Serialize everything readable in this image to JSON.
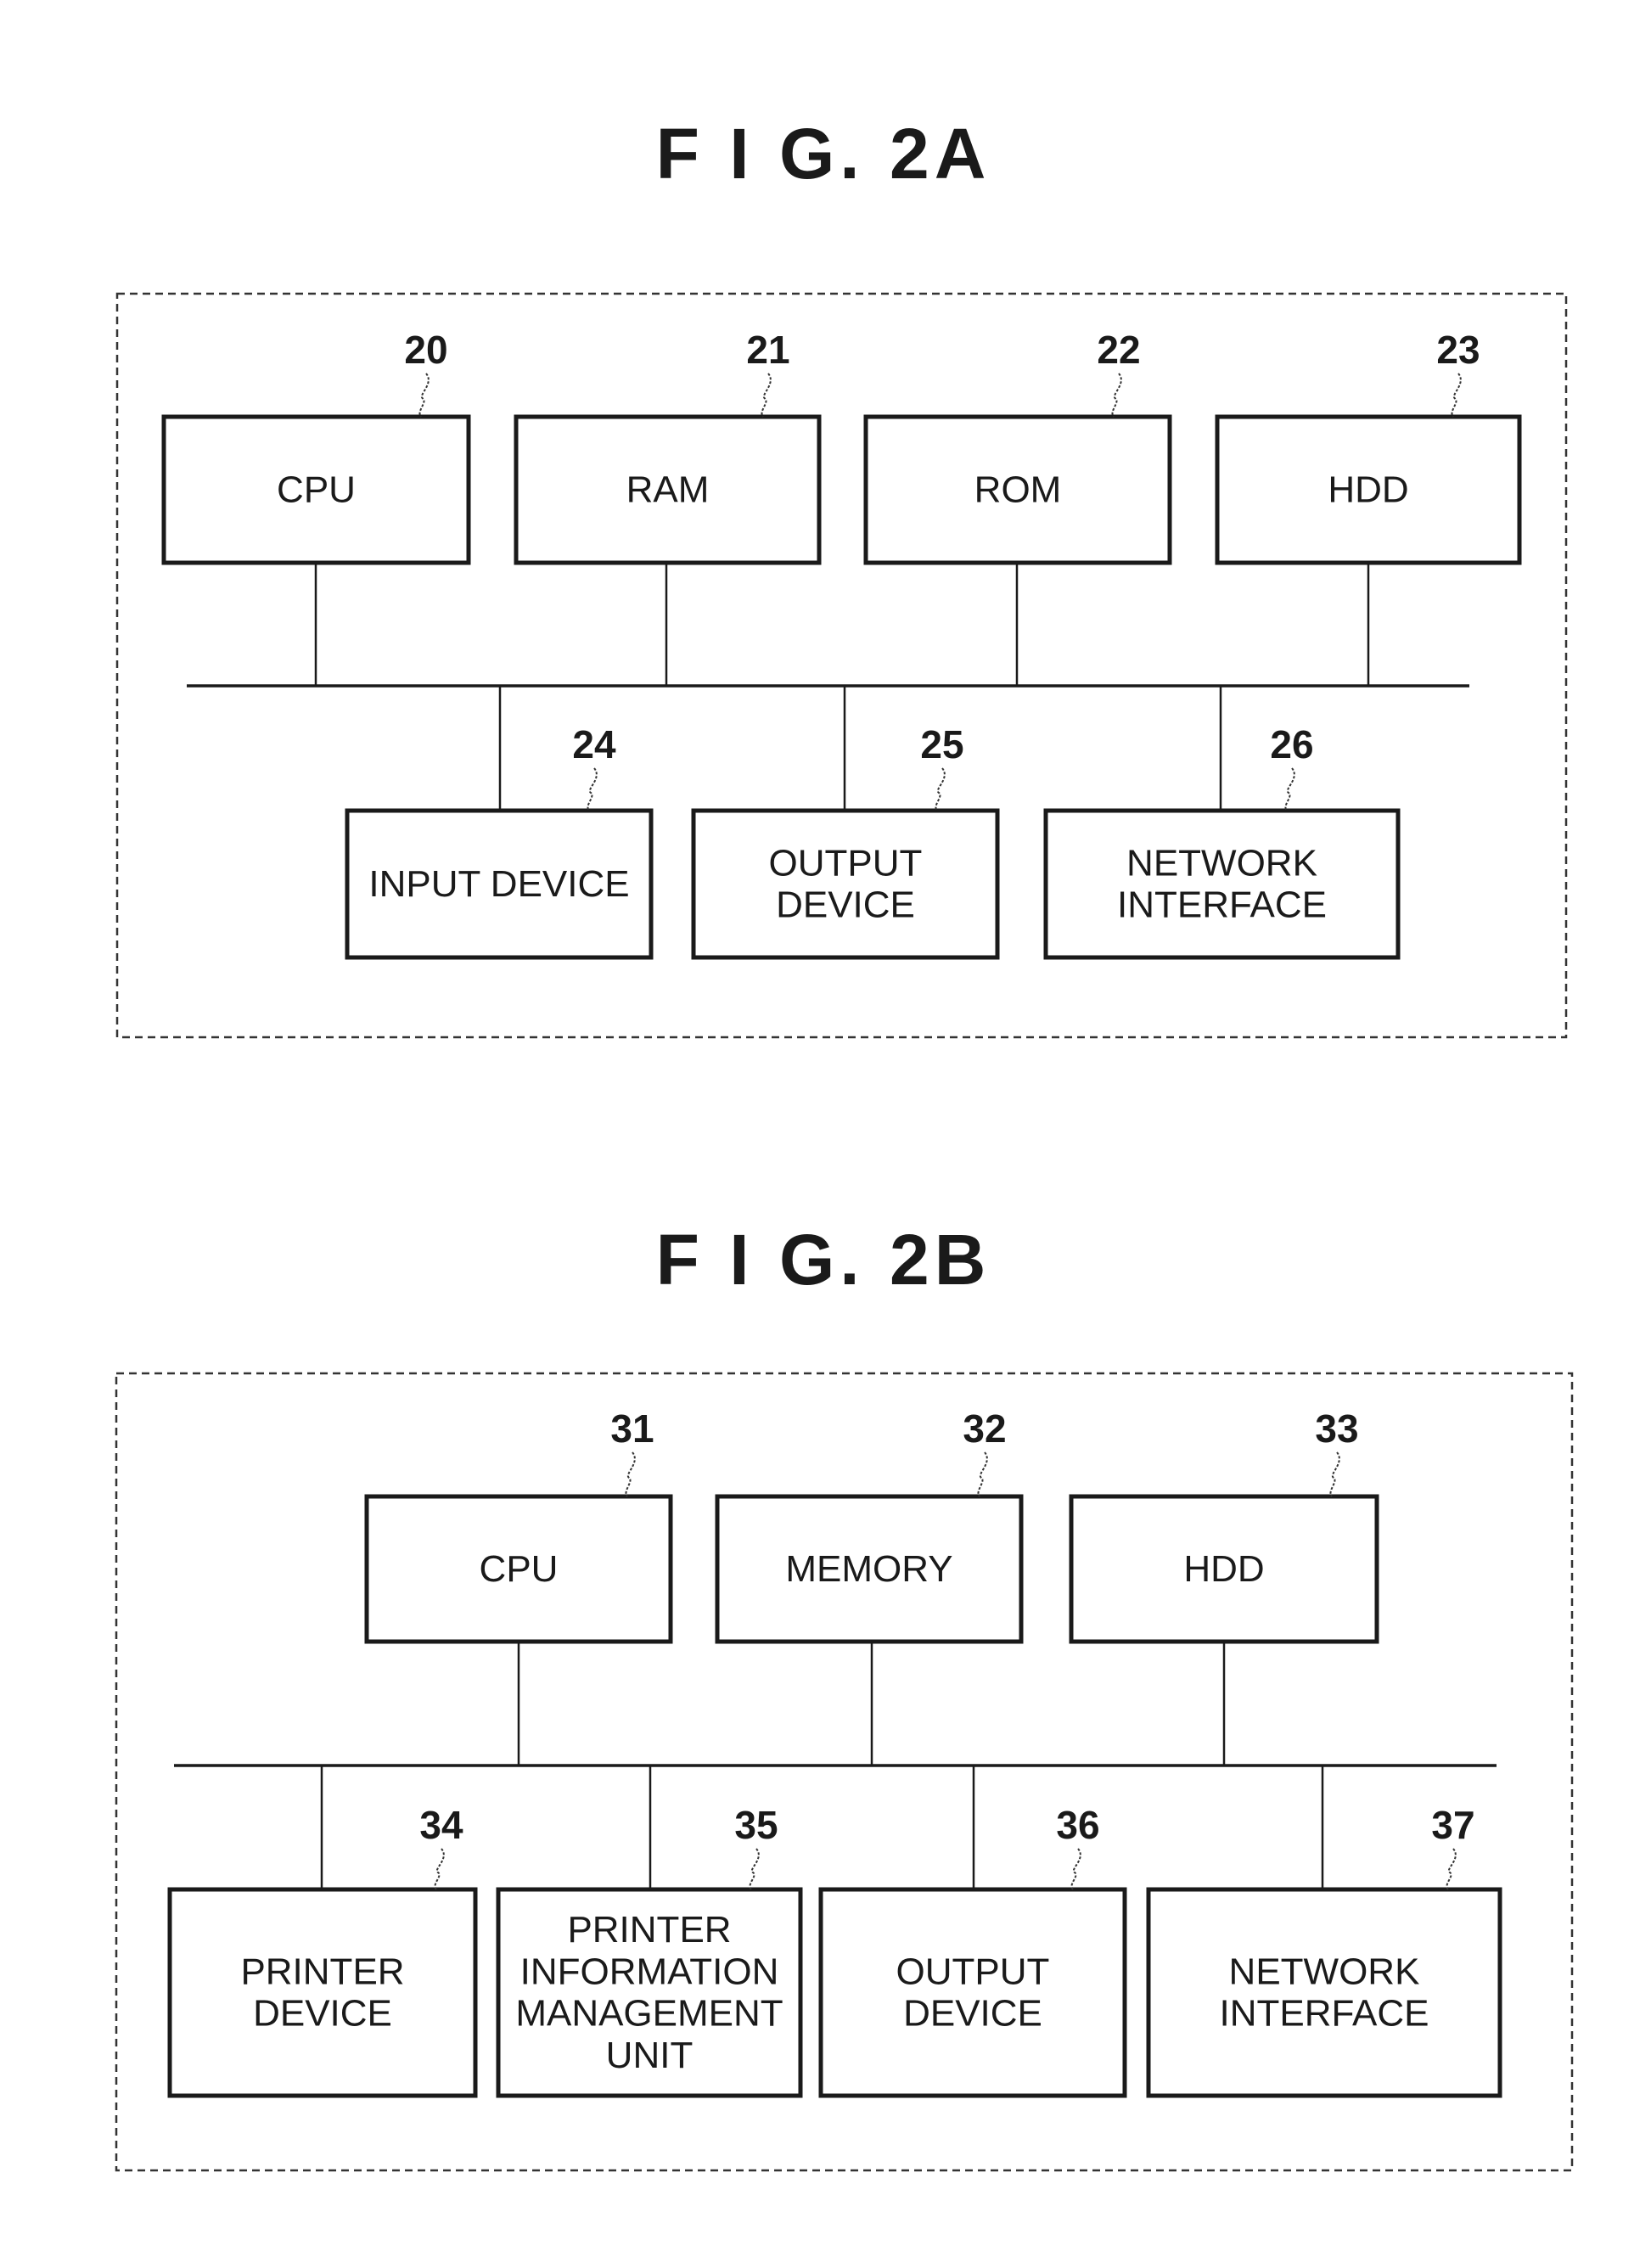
{
  "figures": [
    {
      "id": "fig-2a",
      "title": "F I G.  2A",
      "top_blocks": [
        {
          "ref": "20",
          "lines": [
            "CPU"
          ]
        },
        {
          "ref": "21",
          "lines": [
            "RAM"
          ]
        },
        {
          "ref": "22",
          "lines": [
            "ROM"
          ]
        },
        {
          "ref": "23",
          "lines": [
            "HDD"
          ]
        }
      ],
      "bottom_blocks": [
        {
          "ref": "24",
          "lines": [
            "INPUT DEVICE"
          ]
        },
        {
          "ref": "25",
          "lines": [
            "OUTPUT",
            "DEVICE"
          ]
        },
        {
          "ref": "26",
          "lines": [
            "NETWORK",
            "INTERFACE"
          ]
        }
      ]
    },
    {
      "id": "fig-2b",
      "title": "F I G.  2B",
      "top_blocks": [
        {
          "ref": "31",
          "lines": [
            "CPU"
          ]
        },
        {
          "ref": "32",
          "lines": [
            "MEMORY"
          ]
        },
        {
          "ref": "33",
          "lines": [
            "HDD"
          ]
        }
      ],
      "bottom_blocks": [
        {
          "ref": "34",
          "lines": [
            "PRINTER",
            "DEVICE"
          ]
        },
        {
          "ref": "35",
          "lines": [
            "PRINTER",
            "INFORMATION",
            "MANAGEMENT",
            "UNIT"
          ]
        },
        {
          "ref": "36",
          "lines": [
            "OUTPUT",
            "DEVICE"
          ]
        },
        {
          "ref": "37",
          "lines": [
            "NETWORK",
            "INTERFACE"
          ]
        }
      ]
    }
  ]
}
